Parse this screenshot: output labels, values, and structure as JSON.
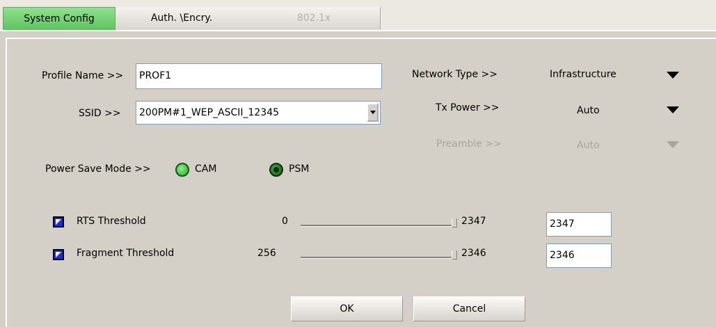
{
  "tabs": [
    {
      "label": "System Config"
    },
    {
      "label": "Auth. \\Encry."
    },
    {
      "label": "802.1x"
    }
  ],
  "profile": {
    "label": "Profile Name >>",
    "value": "PROF1"
  },
  "ssid": {
    "label": "SSID >>",
    "value": "200PM#1_WEP_ASCII_12345"
  },
  "network_type": {
    "label": "Network Type >>",
    "value": "Infrastructure"
  },
  "tx_power": {
    "label": "Tx Power >>",
    "value": "Auto"
  },
  "preamble": {
    "label": "Preamble >>",
    "value": "Auto"
  },
  "power_save": {
    "label": "Power Save Mode >>",
    "cam": "CAM",
    "psm": "PSM"
  },
  "rts": {
    "label": "RTS Threshold",
    "min": "0",
    "max": "2347",
    "value": "2347"
  },
  "fragment": {
    "label": "Fragment Threshold",
    "min": "256",
    "max": "2346",
    "value": "2346"
  },
  "buttons": {
    "ok": "OK",
    "cancel": "Cancel"
  }
}
